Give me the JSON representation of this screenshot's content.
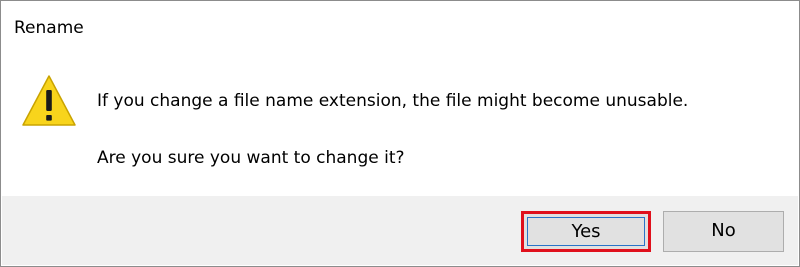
{
  "dialog": {
    "title": "Rename",
    "icon": "warning-triangle-icon",
    "message_line1": "If you change a file name extension, the file might become unusable.",
    "message_line2": "Are you sure you want to change it?",
    "buttons": {
      "yes_label": "Yes",
      "no_label": "No"
    },
    "colors": {
      "warning_fill": "#f8d41c",
      "highlight_border": "#e0101c",
      "footer_bg": "#f0f0f0",
      "button_bg": "#e1e1e1"
    }
  }
}
